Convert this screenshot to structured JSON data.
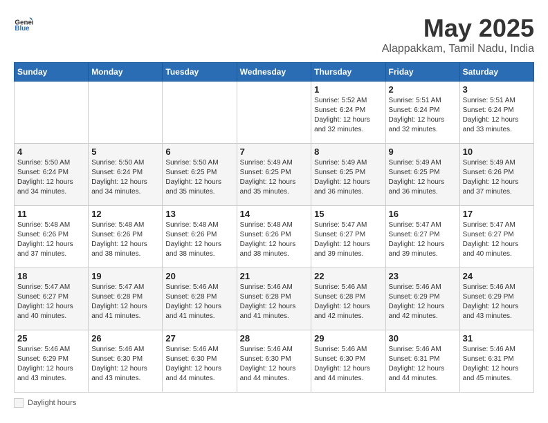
{
  "header": {
    "logo_general": "General",
    "logo_blue": "Blue",
    "month": "May 2025",
    "location": "Alappakkam, Tamil Nadu, India"
  },
  "weekdays": [
    "Sunday",
    "Monday",
    "Tuesday",
    "Wednesday",
    "Thursday",
    "Friday",
    "Saturday"
  ],
  "footer": {
    "daylight_label": "Daylight hours"
  },
  "weeks": [
    [
      {
        "day": "",
        "info": ""
      },
      {
        "day": "",
        "info": ""
      },
      {
        "day": "",
        "info": ""
      },
      {
        "day": "",
        "info": ""
      },
      {
        "day": "1",
        "info": "Sunrise: 5:52 AM\nSunset: 6:24 PM\nDaylight: 12 hours\nand 32 minutes."
      },
      {
        "day": "2",
        "info": "Sunrise: 5:51 AM\nSunset: 6:24 PM\nDaylight: 12 hours\nand 32 minutes."
      },
      {
        "day": "3",
        "info": "Sunrise: 5:51 AM\nSunset: 6:24 PM\nDaylight: 12 hours\nand 33 minutes."
      }
    ],
    [
      {
        "day": "4",
        "info": "Sunrise: 5:50 AM\nSunset: 6:24 PM\nDaylight: 12 hours\nand 34 minutes."
      },
      {
        "day": "5",
        "info": "Sunrise: 5:50 AM\nSunset: 6:24 PM\nDaylight: 12 hours\nand 34 minutes."
      },
      {
        "day": "6",
        "info": "Sunrise: 5:50 AM\nSunset: 6:25 PM\nDaylight: 12 hours\nand 35 minutes."
      },
      {
        "day": "7",
        "info": "Sunrise: 5:49 AM\nSunset: 6:25 PM\nDaylight: 12 hours\nand 35 minutes."
      },
      {
        "day": "8",
        "info": "Sunrise: 5:49 AM\nSunset: 6:25 PM\nDaylight: 12 hours\nand 36 minutes."
      },
      {
        "day": "9",
        "info": "Sunrise: 5:49 AM\nSunset: 6:25 PM\nDaylight: 12 hours\nand 36 minutes."
      },
      {
        "day": "10",
        "info": "Sunrise: 5:49 AM\nSunset: 6:26 PM\nDaylight: 12 hours\nand 37 minutes."
      }
    ],
    [
      {
        "day": "11",
        "info": "Sunrise: 5:48 AM\nSunset: 6:26 PM\nDaylight: 12 hours\nand 37 minutes."
      },
      {
        "day": "12",
        "info": "Sunrise: 5:48 AM\nSunset: 6:26 PM\nDaylight: 12 hours\nand 38 minutes."
      },
      {
        "day": "13",
        "info": "Sunrise: 5:48 AM\nSunset: 6:26 PM\nDaylight: 12 hours\nand 38 minutes."
      },
      {
        "day": "14",
        "info": "Sunrise: 5:48 AM\nSunset: 6:26 PM\nDaylight: 12 hours\nand 38 minutes."
      },
      {
        "day": "15",
        "info": "Sunrise: 5:47 AM\nSunset: 6:27 PM\nDaylight: 12 hours\nand 39 minutes."
      },
      {
        "day": "16",
        "info": "Sunrise: 5:47 AM\nSunset: 6:27 PM\nDaylight: 12 hours\nand 39 minutes."
      },
      {
        "day": "17",
        "info": "Sunrise: 5:47 AM\nSunset: 6:27 PM\nDaylight: 12 hours\nand 40 minutes."
      }
    ],
    [
      {
        "day": "18",
        "info": "Sunrise: 5:47 AM\nSunset: 6:27 PM\nDaylight: 12 hours\nand 40 minutes."
      },
      {
        "day": "19",
        "info": "Sunrise: 5:47 AM\nSunset: 6:28 PM\nDaylight: 12 hours\nand 41 minutes."
      },
      {
        "day": "20",
        "info": "Sunrise: 5:46 AM\nSunset: 6:28 PM\nDaylight: 12 hours\nand 41 minutes."
      },
      {
        "day": "21",
        "info": "Sunrise: 5:46 AM\nSunset: 6:28 PM\nDaylight: 12 hours\nand 41 minutes."
      },
      {
        "day": "22",
        "info": "Sunrise: 5:46 AM\nSunset: 6:28 PM\nDaylight: 12 hours\nand 42 minutes."
      },
      {
        "day": "23",
        "info": "Sunrise: 5:46 AM\nSunset: 6:29 PM\nDaylight: 12 hours\nand 42 minutes."
      },
      {
        "day": "24",
        "info": "Sunrise: 5:46 AM\nSunset: 6:29 PM\nDaylight: 12 hours\nand 43 minutes."
      }
    ],
    [
      {
        "day": "25",
        "info": "Sunrise: 5:46 AM\nSunset: 6:29 PM\nDaylight: 12 hours\nand 43 minutes."
      },
      {
        "day": "26",
        "info": "Sunrise: 5:46 AM\nSunset: 6:30 PM\nDaylight: 12 hours\nand 43 minutes."
      },
      {
        "day": "27",
        "info": "Sunrise: 5:46 AM\nSunset: 6:30 PM\nDaylight: 12 hours\nand 44 minutes."
      },
      {
        "day": "28",
        "info": "Sunrise: 5:46 AM\nSunset: 6:30 PM\nDaylight: 12 hours\nand 44 minutes."
      },
      {
        "day": "29",
        "info": "Sunrise: 5:46 AM\nSunset: 6:30 PM\nDaylight: 12 hours\nand 44 minutes."
      },
      {
        "day": "30",
        "info": "Sunrise: 5:46 AM\nSunset: 6:31 PM\nDaylight: 12 hours\nand 44 minutes."
      },
      {
        "day": "31",
        "info": "Sunrise: 5:46 AM\nSunset: 6:31 PM\nDaylight: 12 hours\nand 45 minutes."
      }
    ]
  ]
}
